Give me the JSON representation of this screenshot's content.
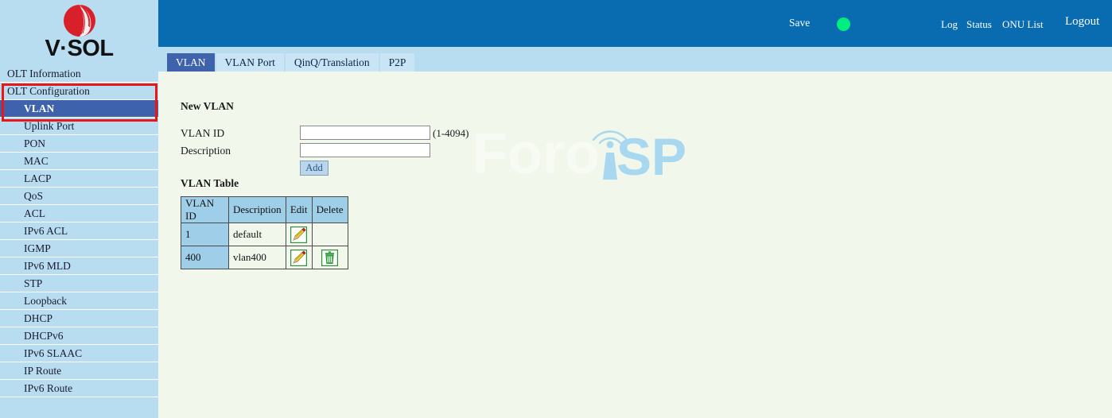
{
  "brand": {
    "logo_text": "V·SOL",
    "logo_icon": "vsol-sphere-logo",
    "logo_color": "#d8202a"
  },
  "sidebar": {
    "items": [
      {
        "label": "OLT Information",
        "level": 1,
        "selected": false,
        "name": "sidebar-item-olt-information"
      },
      {
        "label": "OLT Configuration",
        "level": 1,
        "selected": false,
        "name": "sidebar-item-olt-configuration"
      },
      {
        "label": "VLAN",
        "level": 2,
        "selected": true,
        "name": "sidebar-item-vlan"
      },
      {
        "label": "Uplink Port",
        "level": 2,
        "selected": false,
        "name": "sidebar-item-uplink-port"
      },
      {
        "label": "PON",
        "level": 2,
        "selected": false,
        "name": "sidebar-item-pon"
      },
      {
        "label": "MAC",
        "level": 2,
        "selected": false,
        "name": "sidebar-item-mac"
      },
      {
        "label": "LACP",
        "level": 2,
        "selected": false,
        "name": "sidebar-item-lacp"
      },
      {
        "label": "QoS",
        "level": 2,
        "selected": false,
        "name": "sidebar-item-qos"
      },
      {
        "label": "ACL",
        "level": 2,
        "selected": false,
        "name": "sidebar-item-acl"
      },
      {
        "label": "IPv6 ACL",
        "level": 2,
        "selected": false,
        "name": "sidebar-item-ipv6-acl"
      },
      {
        "label": "IGMP",
        "level": 2,
        "selected": false,
        "name": "sidebar-item-igmp"
      },
      {
        "label": "IPv6 MLD",
        "level": 2,
        "selected": false,
        "name": "sidebar-item-ipv6-mld"
      },
      {
        "label": "STP",
        "level": 2,
        "selected": false,
        "name": "sidebar-item-stp"
      },
      {
        "label": "Loopback",
        "level": 2,
        "selected": false,
        "name": "sidebar-item-loopback"
      },
      {
        "label": "DHCP",
        "level": 2,
        "selected": false,
        "name": "sidebar-item-dhcp"
      },
      {
        "label": "DHCPv6",
        "level": 2,
        "selected": false,
        "name": "sidebar-item-dhcpv6"
      },
      {
        "label": "IPv6 SLAAC",
        "level": 2,
        "selected": false,
        "name": "sidebar-item-ipv6-slaac"
      },
      {
        "label": "IP Route",
        "level": 2,
        "selected": false,
        "name": "sidebar-item-ip-route"
      },
      {
        "label": "IPv6 Route",
        "level": 2,
        "selected": false,
        "name": "sidebar-item-ipv6-route"
      }
    ],
    "highlight_color": "#e8171a",
    "selected_bg": "#3f62ad",
    "bg": "#b8dcf0"
  },
  "header": {
    "bg": "#0a6cb0",
    "save_label": "Save",
    "status_dot_color": "#00ee7d",
    "links": [
      {
        "label": "Log",
        "name": "header-link-log"
      },
      {
        "label": "Status",
        "name": "header-link-status"
      },
      {
        "label": "ONU List",
        "name": "header-link-onu-list"
      }
    ],
    "logout_label": "Logout"
  },
  "tabs": [
    {
      "label": "VLAN",
      "active": true,
      "name": "tab-vlan"
    },
    {
      "label": "VLAN Port",
      "active": false,
      "name": "tab-vlan-port"
    },
    {
      "label": "QinQ/Translation",
      "active": false,
      "name": "tab-qinq-translation"
    },
    {
      "label": "P2P",
      "active": false,
      "name": "tab-p2p"
    }
  ],
  "main": {
    "new_vlan_title": "New VLAN",
    "form": {
      "vlan_id_label": "VLAN ID",
      "vlan_id_value": "",
      "vlan_id_placeholder": "",
      "vlan_id_hint": "(1-4094)",
      "description_label": "Description",
      "description_value": "",
      "description_placeholder": "",
      "add_button_label": "Add"
    },
    "table_title": "VLAN Table",
    "table": {
      "columns": [
        "VLAN ID",
        "Description",
        "Edit",
        "Delete"
      ],
      "rows": [
        {
          "vlan_id": "1",
          "description": "default",
          "edit_icon": "pencil-edit-icon",
          "delete_icon": ""
        },
        {
          "vlan_id": "400",
          "description": "vlan400",
          "edit_icon": "pencil-edit-icon",
          "delete_icon": "trash-delete-icon"
        }
      ]
    }
  },
  "watermark": {
    "text_light": "Foro",
    "text_accent": "ISP",
    "accent_color": "#a8d8ef",
    "light_color": "#f8fbf4",
    "icon": "wifi-signal-arcs-icon"
  }
}
